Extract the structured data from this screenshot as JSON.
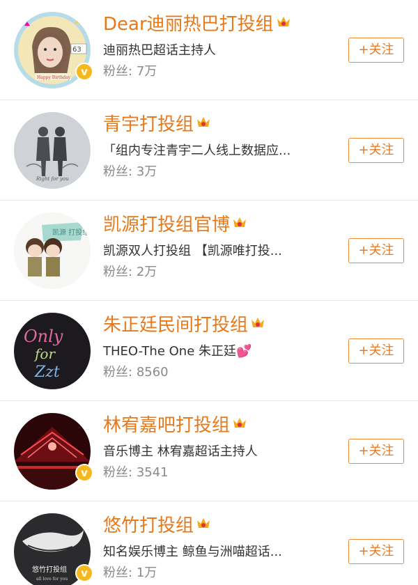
{
  "accounts": [
    {
      "name": "Dear迪丽热巴打投组",
      "desc": "迪丽热巴超话主持人",
      "fans_label": "粉丝:",
      "fans": "7万",
      "follow": "+关注",
      "avatar_texts": [
        "63",
        "Happy Birthday"
      ],
      "verified": true
    },
    {
      "name": "青宇打投组",
      "desc": "「组内专注青宇二人线上数据应...",
      "fans_label": "粉丝:",
      "fans": "3万",
      "follow": "+关注",
      "avatar_texts": [
        "Right for you"
      ],
      "verified": false
    },
    {
      "name": "凯源打投组官博",
      "desc": "凯源双人打投组 【凯源唯打投...",
      "fans_label": "粉丝:",
      "fans": "2万",
      "follow": "+关注",
      "avatar_texts": [
        "凯源 打投组"
      ],
      "verified": false
    },
    {
      "name": "朱正廷民间打投组",
      "desc": "THEO-The One 朱正廷",
      "fans_label": "粉丝:",
      "fans": "8560",
      "follow": "+关注",
      "avatar_texts": [
        "Only",
        "for",
        "Zzt"
      ],
      "verified": false
    },
    {
      "name": "林宥嘉吧打投组",
      "desc": "音乐博主 林宥嘉超话主持人",
      "fans_label": "粉丝:",
      "fans": "3541",
      "follow": "+关注",
      "avatar_texts": [],
      "verified": true
    },
    {
      "name": "悠竹打投组",
      "desc": "知名娱乐博主 鲸鱼与洲喵超话...",
      "fans_label": "粉丝:",
      "fans": "1万",
      "follow": "+关注",
      "avatar_texts": [
        "悠竹打投组",
        "all love for you"
      ],
      "verified": true
    }
  ],
  "colors": {
    "name": "#e8791a",
    "follow": "#eb7a22",
    "badge": "#f6b81c",
    "fans": "#8a8a8a"
  }
}
